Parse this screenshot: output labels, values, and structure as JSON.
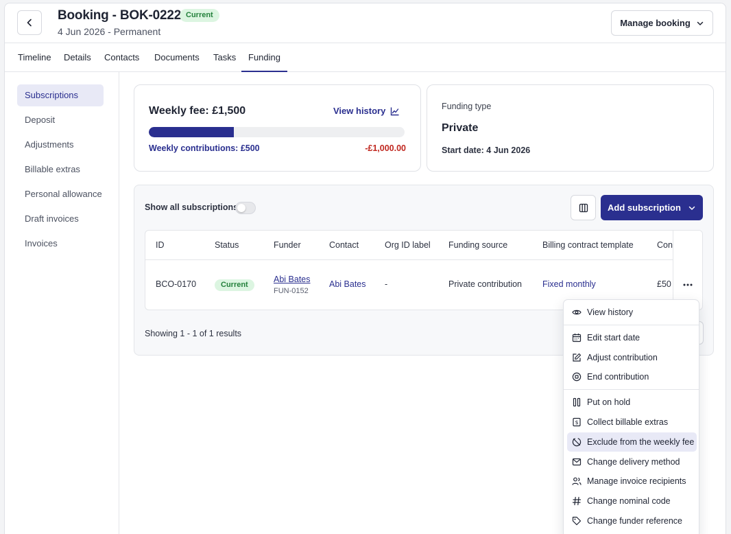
{
  "header": {
    "title": "Booking - BOK-0222",
    "status_badge": "Current",
    "subtitle": "4 Jun 2026 - Permanent",
    "manage_label": "Manage booking"
  },
  "tabs": [
    {
      "label": "Timeline"
    },
    {
      "label": "Details"
    },
    {
      "label": "Contacts"
    },
    {
      "label": "Documents"
    },
    {
      "label": "Tasks"
    },
    {
      "label": "Funding",
      "active": true
    }
  ],
  "sidenav": [
    {
      "label": "Subscriptions",
      "active": true
    },
    {
      "label": "Deposit"
    },
    {
      "label": "Adjustments"
    },
    {
      "label": "Billable extras"
    },
    {
      "label": "Personal allowance"
    },
    {
      "label": "Draft invoices"
    },
    {
      "label": "Invoices"
    }
  ],
  "fee_card": {
    "title": "Weekly fee: £1,500",
    "view_history": "View history",
    "progress_fraction": 0.333,
    "contributions": "Weekly contributions: £500",
    "difference": "-£1,000.00"
  },
  "funding_card": {
    "label": "Funding type",
    "value": "Private",
    "start_date": "Start date: 4 Jun 2026"
  },
  "subscriptions": {
    "show_all_label": "Show all subscriptions",
    "show_all_on": false,
    "add_label": "Add subscription",
    "columns": [
      "ID",
      "Status",
      "Funder",
      "Contact",
      "Org ID label",
      "Funding source",
      "Billing contract template",
      "Con"
    ],
    "rows": [
      {
        "id": "BCO-0170",
        "status": "Current",
        "funder": "Abi Bates",
        "funder_id": "FUN-0152",
        "contact": "Abi Bates",
        "org_id": "-",
        "source": "Private contribution",
        "template": "Fixed monthly",
        "contribution": "£50"
      }
    ],
    "showing": "Showing 1 - 1 of 1 results"
  },
  "menu": {
    "items": [
      {
        "label": "View history",
        "icon": "eye-icon"
      },
      {
        "label": "Edit start date",
        "icon": "calendar-icon"
      },
      {
        "label": "Adjust contribution",
        "icon": "edit-icon"
      },
      {
        "label": "End contribution",
        "icon": "stop-circle-icon"
      },
      {
        "label": "Put on hold",
        "icon": "pause-icon"
      },
      {
        "label": "Collect billable extras",
        "icon": "receipt-icon"
      },
      {
        "label": "Exclude from the weekly fee",
        "icon": "exclude-icon",
        "highlighted": true
      },
      {
        "label": "Change delivery method",
        "icon": "mail-icon"
      },
      {
        "label": "Manage invoice recipients",
        "icon": "users-icon"
      },
      {
        "label": "Change nominal code",
        "icon": "hash-icon"
      },
      {
        "label": "Change funder reference",
        "icon": "tag-icon"
      }
    ]
  },
  "colors": {
    "accent": "#2a2f8f",
    "success_bg": "#dcf5e1",
    "success_text": "#23803b",
    "danger": "#c0271f"
  }
}
